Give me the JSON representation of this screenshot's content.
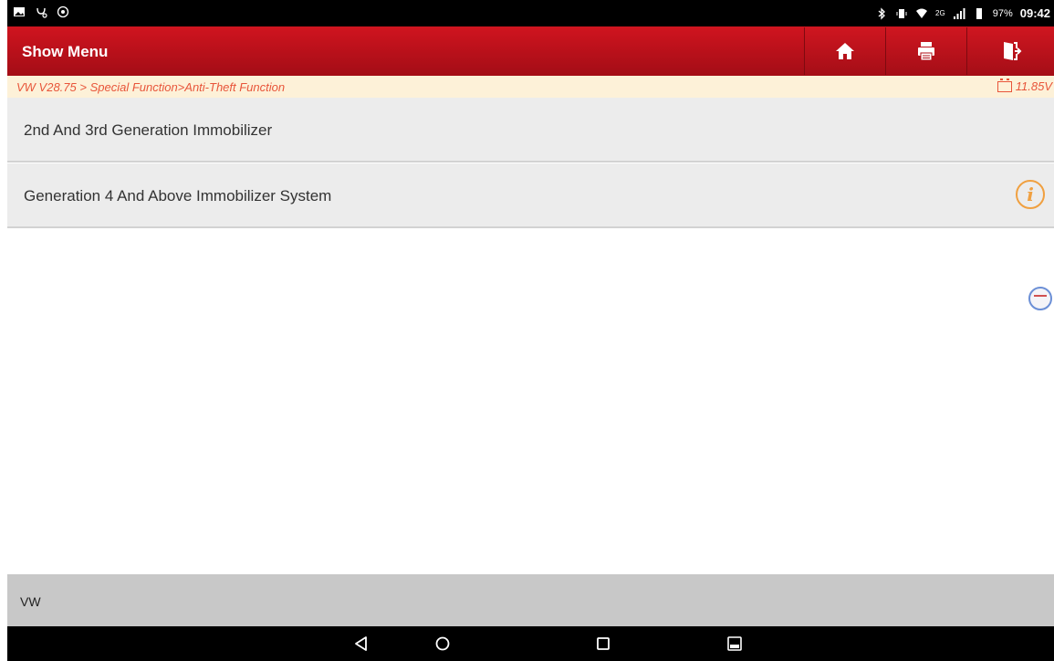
{
  "status_bar": {
    "battery_percent": "97%",
    "time": "09:42",
    "network": "2G"
  },
  "header": {
    "title": "Show Menu",
    "buttons": [
      "home-icon",
      "print-icon",
      "exit-icon"
    ]
  },
  "breadcrumb": {
    "path": "VW V28.75 > Special Function>Anti-Theft Function",
    "voltage": "11.85V"
  },
  "menu": {
    "items": [
      {
        "label": "2nd And 3rd Generation Immobilizer",
        "has_info": false
      },
      {
        "label": "Generation 4 And Above Immobilizer System",
        "has_info": true
      }
    ]
  },
  "footer": {
    "label": "VW"
  },
  "colors": {
    "header_red": "#c0121c",
    "breadcrumb_text": "#e8553a",
    "breadcrumb_bg": "#fdf1d8",
    "info_orange": "#f0a040"
  }
}
